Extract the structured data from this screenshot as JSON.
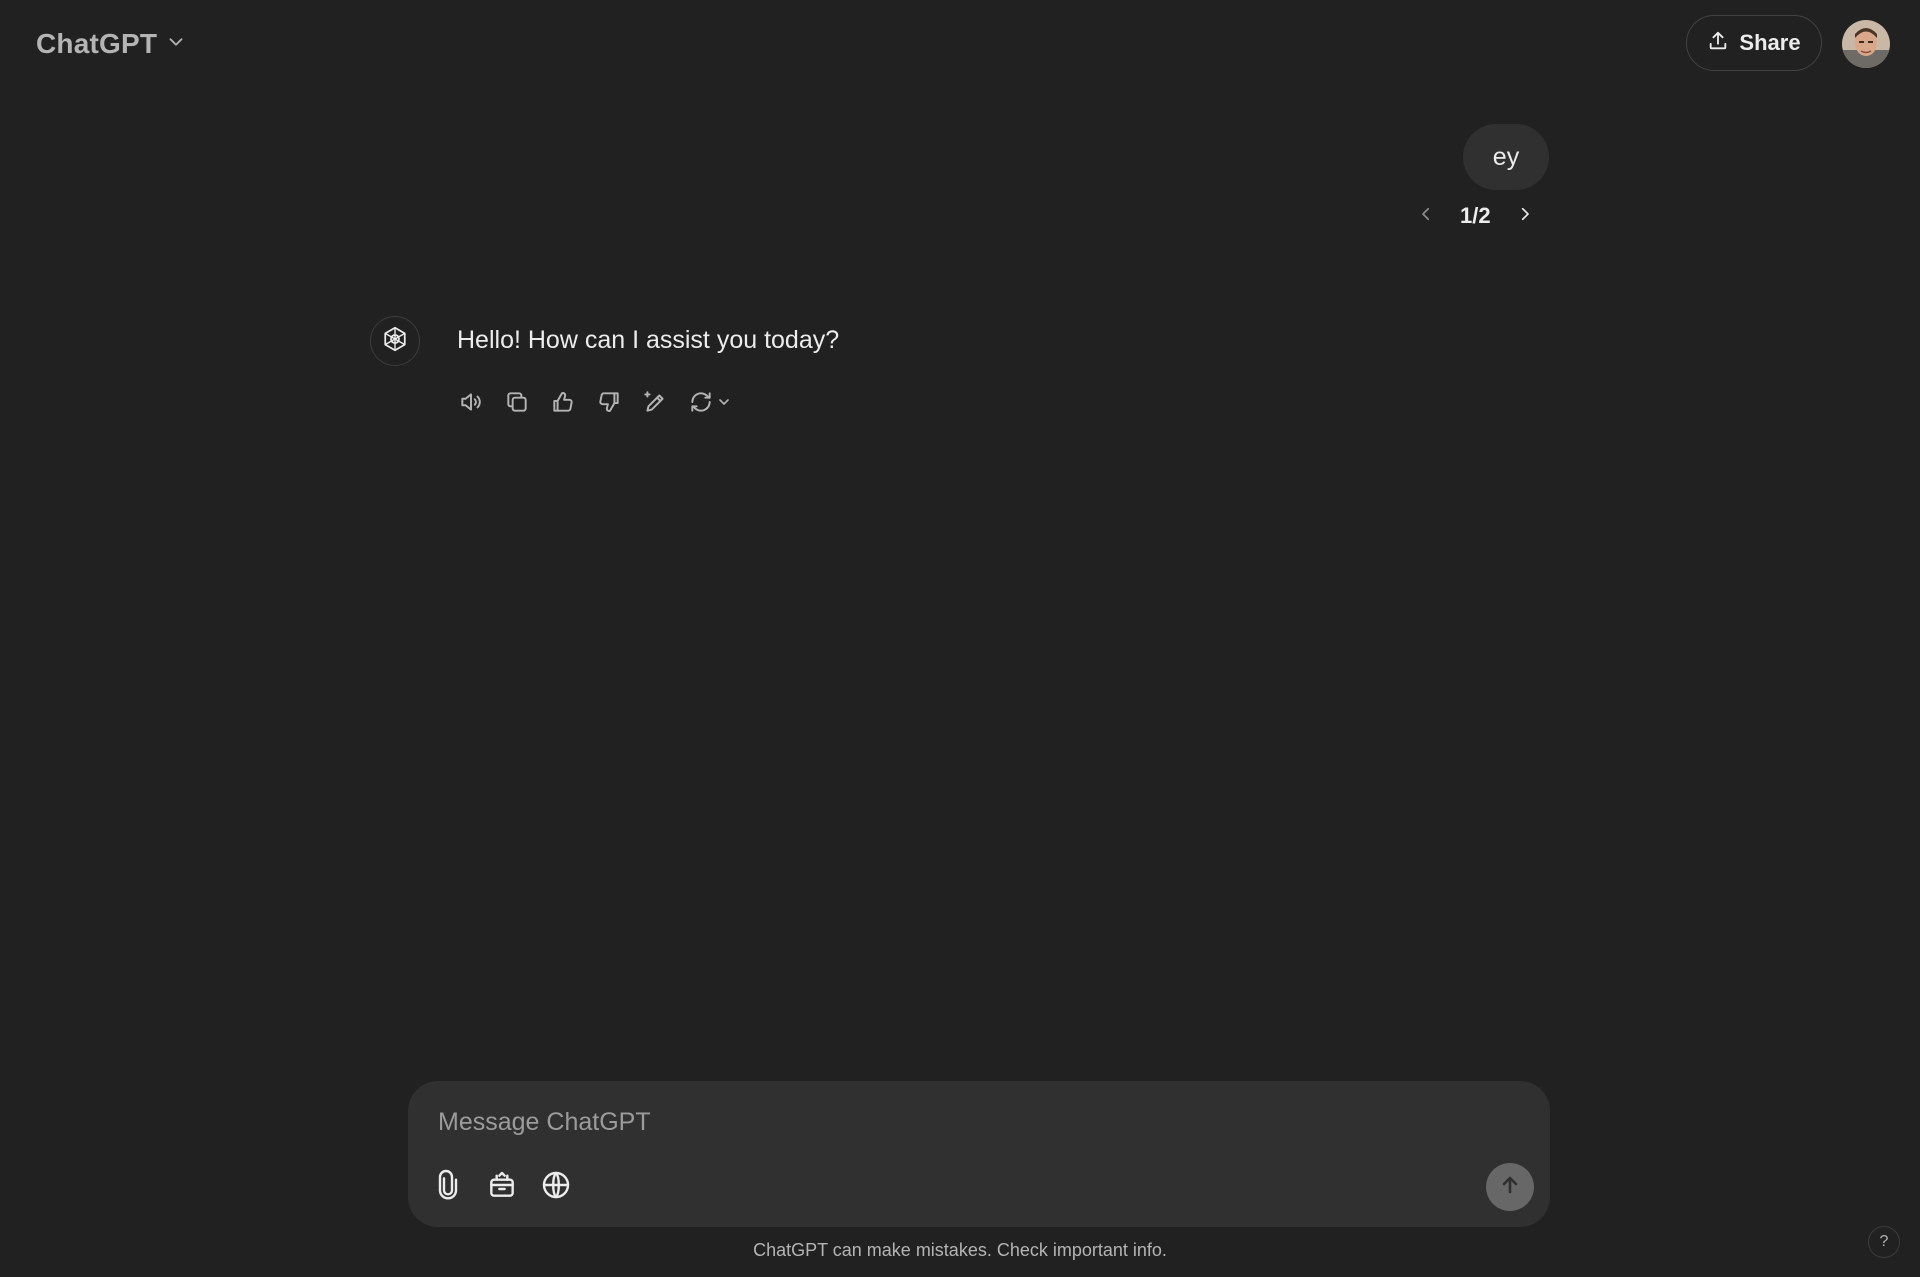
{
  "header": {
    "model_name": "ChatGPT",
    "share_label": "Share"
  },
  "conversation": {
    "user_message": "ey",
    "pager": {
      "current": 1,
      "total": 2,
      "label": "1/2"
    },
    "assistant_message": "Hello! How can I assist you today?"
  },
  "composer": {
    "placeholder": "Message ChatGPT"
  },
  "footer": {
    "disclaimer": "ChatGPT can make mistakes. Check important info.",
    "help_label": "?"
  },
  "icons": {
    "model_dropdown": "chevron-down-icon",
    "share": "upload-icon",
    "pager_prev": "chevron-left-icon",
    "pager_next": "chevron-right-icon",
    "assistant_avatar": "openai-logo-icon",
    "actions": [
      "speaker-icon",
      "copy-icon",
      "thumbs-up-icon",
      "thumbs-down-icon",
      "edit-sparkle-icon",
      "regenerate-icon"
    ],
    "composer_tools": [
      "paperclip-icon",
      "toolbox-icon",
      "globe-icon"
    ],
    "send": "arrow-up-icon"
  },
  "colors": {
    "background": "#212121",
    "surface": "#303030",
    "text": "#ececec",
    "muted": "#b4b4b4",
    "send_disabled": "#676767"
  }
}
